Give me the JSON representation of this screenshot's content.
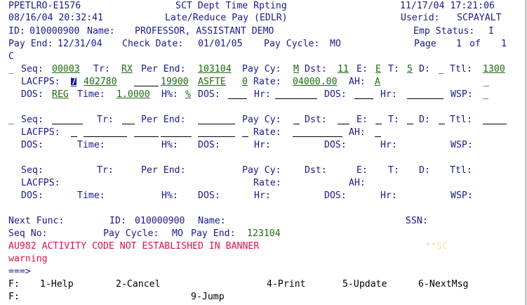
{
  "header": {
    "program": "PPETLRO-E1576",
    "title": "SCT Dept Time Rpting",
    "datetime_right": "11/17/04 17:21:06",
    "datetime_left": "08/16/04 20:32:41",
    "subtitle": "Late/Reduce Pay (EDLR)",
    "userid_label": "Userid:",
    "userid": "SCPAYALT",
    "id_label": "ID:",
    "id": "010000900",
    "name_label": "Name:",
    "name": "PROFESSOR, ASSISTANT DEMO",
    "emp_status_label": "Emp Status:",
    "emp_status": "I",
    "pay_end_label": "Pay End:",
    "pay_end": "12/31/04",
    "check_date_label": "Check Date:",
    "check_date": "01/01/05",
    "pay_cycle_label": "Pay Cycle:",
    "pay_cycle": "MO",
    "page_label": "Page",
    "page_num": "1",
    "page_of": "of",
    "page_total": "1",
    "c_flag": "C"
  },
  "labels": {
    "seq": "Seq:",
    "tr": "Tr:",
    "per_end": "Per End:",
    "pay_cy": "Pay Cy:",
    "dst": "Dst:",
    "e": "E:",
    "t": "T:",
    "d": "D:",
    "ttl": "Ttl:",
    "lacfps": "LACFPS:",
    "rate": "Rate:",
    "ah": "AH:",
    "dos": "DOS:",
    "time": "Time:",
    "hpct": "H%:",
    "hr": "Hr:",
    "wsp": "WSP:"
  },
  "record1": {
    "seq": "00003",
    "tr": "RX",
    "per_end": "103104",
    "pay_cy": "M",
    "dst": "11",
    "e": "E",
    "t": "5",
    "ttl": "1300",
    "lacfps_l": "7",
    "lacfps_a": "402780",
    "lacfps_f": "19900",
    "lacfps_p": "ASFTE",
    "lacfps_s": "0",
    "rate": "04000.00",
    "ah": "A",
    "dos": "REG",
    "time": "1.0000",
    "hpct": "%"
  },
  "footer": {
    "next_func_label": "Next Func:",
    "id_label": "ID:",
    "id": "010000900",
    "name_label": "Name:",
    "ssn_label": "SSN:",
    "seq_no_label": "Seq No:",
    "pay_cycle_label": "Pay Cycle:",
    "pay_cycle": "MO",
    "pay_end_label": "Pay End:",
    "pay_end": "123104",
    "error_msg": "AU982 ACTIVITY CODE NOT ESTABLISHED IN BANNER",
    "ghost_text": "**SC",
    "warning": "warning",
    "prompt": "===>",
    "fkeys_label": "F:",
    "f1": "1-Help",
    "f2": "2-Cancel",
    "f4": "4-Print",
    "f5": "5-Update",
    "f6": "6-NextMsg",
    "f9": "9-Jump"
  }
}
